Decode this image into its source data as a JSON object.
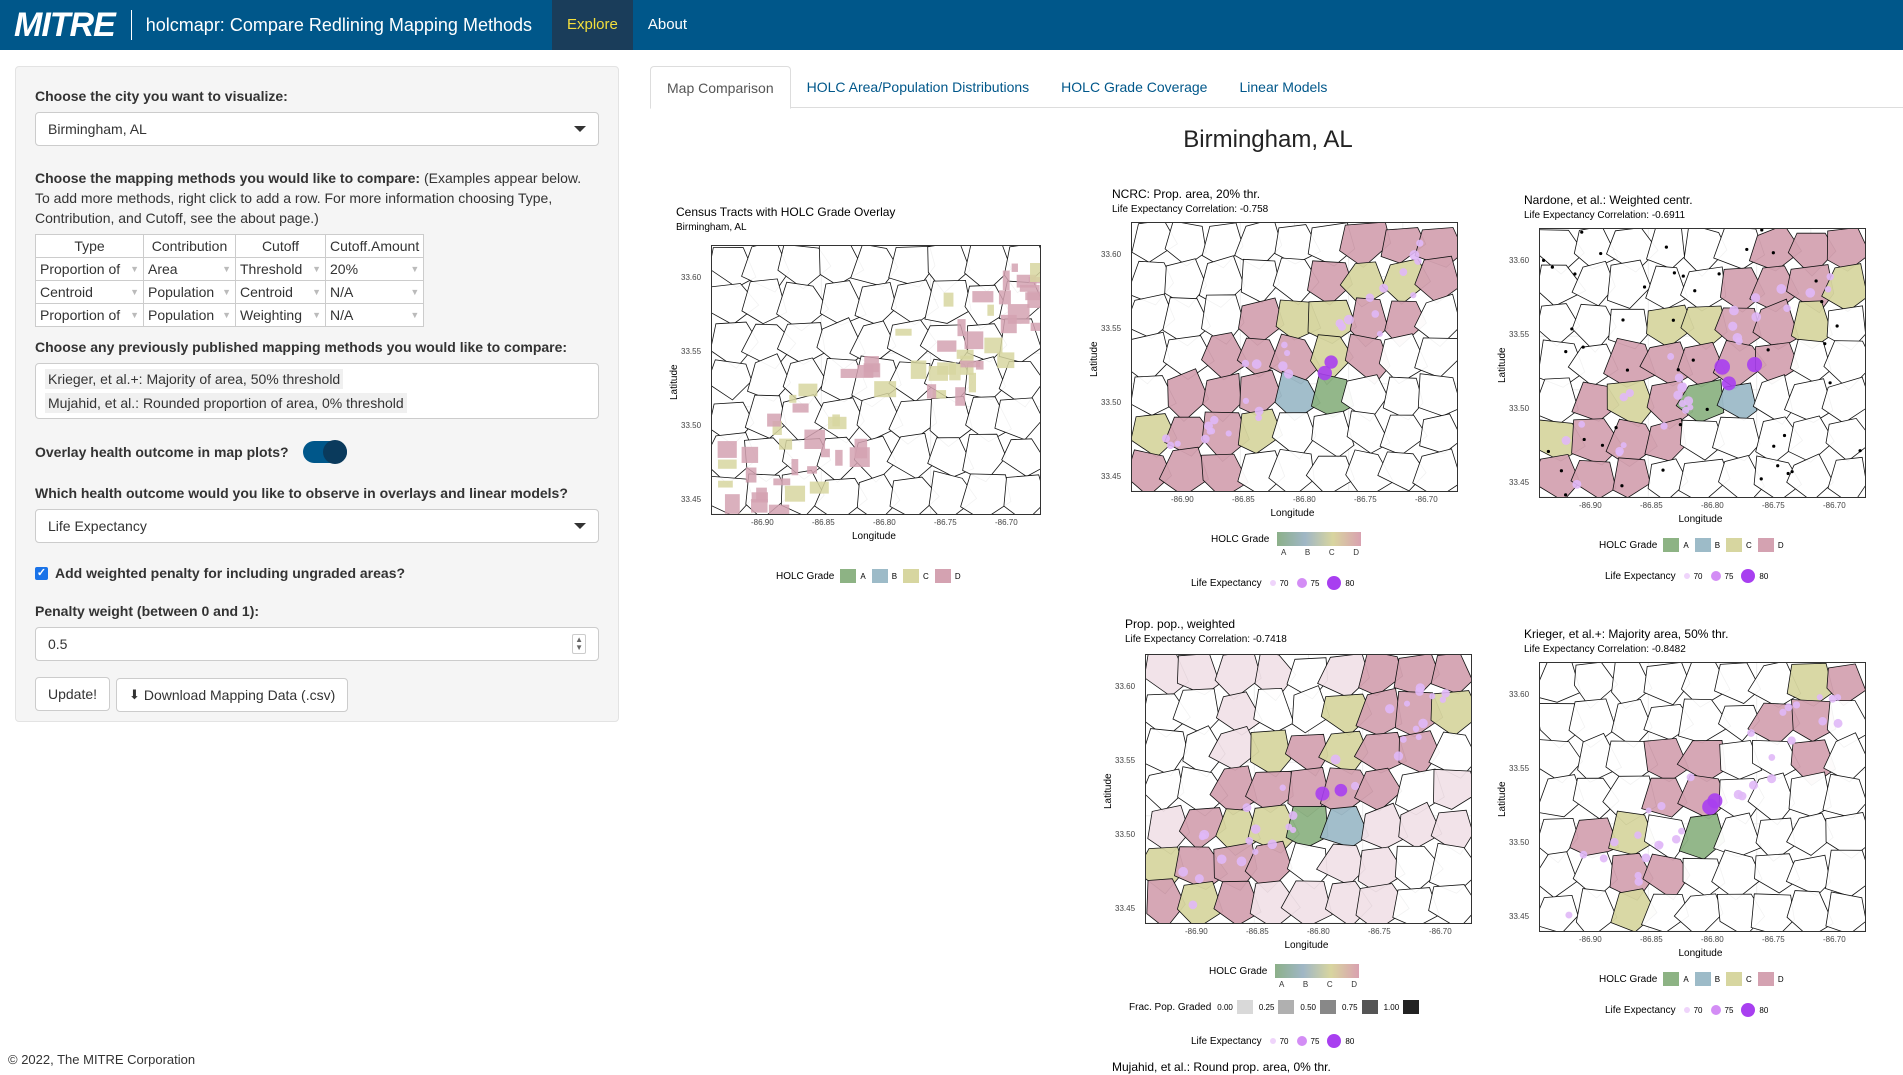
{
  "navbar": {
    "logo": "MITRE",
    "title": "holcmapr: Compare Redlining Mapping Methods",
    "tabs": [
      "Explore",
      "About"
    ]
  },
  "sidebar": {
    "city_label": "Choose the city you want to visualize:",
    "city_value": "Birmingham, AL",
    "methods_label": "Choose the mapping methods you would like to compare:",
    "methods_help": "(Examples appear below. To add more methods, right click to add a row. For more information choosing Type, Contribution, and Cutoff, see the about page.)",
    "table": {
      "headers": [
        "Type",
        "Contribution",
        "Cutoff",
        "Cutoff.Amount"
      ],
      "rows": [
        [
          "Proportion of",
          "Area",
          "Threshold",
          "20%"
        ],
        [
          "Centroid",
          "Population",
          "Centroid",
          "N/A"
        ],
        [
          "Proportion of",
          "Population",
          "Weighting",
          "N/A"
        ]
      ]
    },
    "published_label": "Choose any previously published mapping methods you would like to compare:",
    "published_selected": [
      "Krieger, et al.+: Majority of area, 50% threshold",
      "Mujahid, et al.: Rounded proportion of area, 0% threshold"
    ],
    "overlay_label": "Overlay health outcome in map plots?",
    "overlay_on": true,
    "health_label": "Which health outcome would you like to observe in overlays and linear models?",
    "health_value": "Life Expectancy",
    "penalty_check_label": "Add weighted penalty for including ungraded areas?",
    "penalty_checked": true,
    "penalty_weight_label": "Penalty weight (between 0 and 1):",
    "penalty_weight_value": "0.5",
    "update_button": "Update!",
    "download_button": "Download Mapping Data (.csv)"
  },
  "footer": "© 2022, The MITRE Corporation",
  "main": {
    "tabs": [
      "Map Comparison",
      "HOLC Area/Population Distributions",
      "HOLC Grade Coverage",
      "Linear Models"
    ],
    "title": "Birmingham, AL",
    "common": {
      "xlabel": "Longitude",
      "ylabel": "Latitude",
      "x_ticks": [
        "-86.90",
        "-86.85",
        "-86.80",
        "-86.75",
        "-86.70"
      ],
      "y_ticks": [
        "33.60",
        "33.55",
        "33.50",
        "33.45"
      ],
      "holc_legend_title": "HOLC Grade",
      "grades": [
        "A",
        "B",
        "C",
        "D"
      ],
      "life_legend_title": "Life Expectancy",
      "life_values": [
        "70",
        "75",
        "80"
      ],
      "frac_legend_title": "Frac. Pop. Graded",
      "frac_values": [
        "0.00",
        "0.25",
        "0.50",
        "0.75",
        "1.00"
      ]
    },
    "colors": {
      "A": "#8db384",
      "B": "#9dbbc8",
      "C": "#d7d6a0",
      "D": "#d4a2b1",
      "dot": "#b65af0"
    },
    "maps": [
      {
        "title": "Census Tracts with HOLC Grade Overlay",
        "subtitle": "Birmingham, AL"
      },
      {
        "title": "NCRC: Prop. area, 20% thr.",
        "subtitle": "Life Expectancy Correlation: -0.758"
      },
      {
        "title": "Nardone, et al.: Weighted centr.",
        "subtitle": "Life Expectancy Correlation: -0.6911"
      },
      {
        "title": "Prop. pop., weighted",
        "subtitle": "Life Expectancy Correlation: -0.7418"
      },
      {
        "title": "Krieger, et al.+: Majority area, 50% thr.",
        "subtitle": "Life Expectancy Correlation: -0.8482"
      },
      {
        "title": "Mujahid, et al.: Round prop. area, 0% thr.",
        "subtitle": ""
      }
    ]
  }
}
